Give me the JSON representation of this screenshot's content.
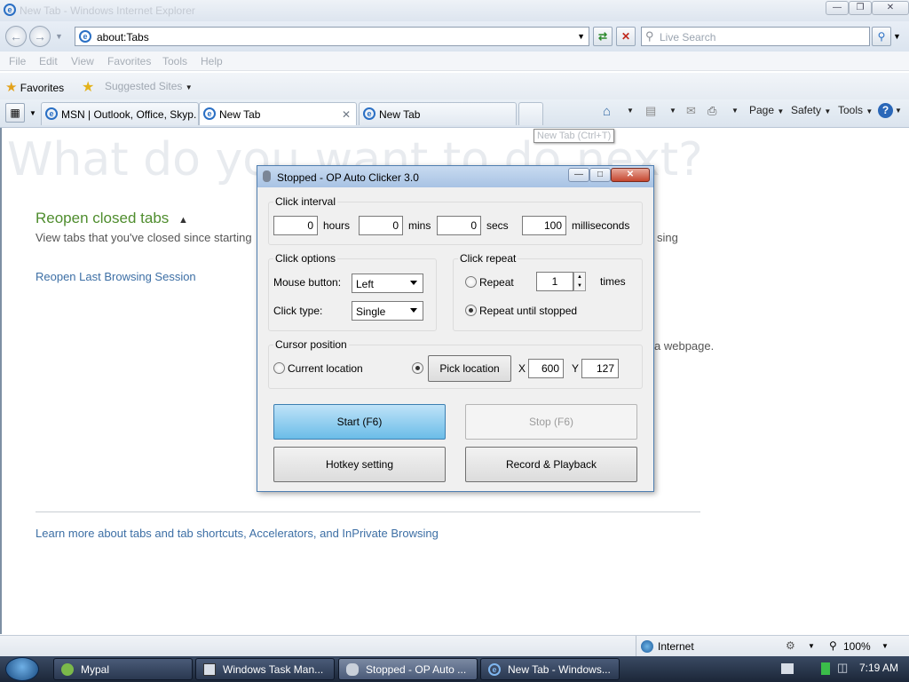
{
  "browser": {
    "window_title": "New Tab - Windows Internet Explorer",
    "address": "about:Tabs",
    "search_placeholder": "Live Search",
    "menu": [
      "File",
      "Edit",
      "View",
      "Favorites",
      "Tools",
      "Help"
    ],
    "favorites_label": "Favorites",
    "suggested_sites_label": "Suggested Sites",
    "tabs": [
      {
        "label": "MSN | Outlook, Office, Skyp..."
      },
      {
        "label": "New Tab"
      },
      {
        "label": "New Tab"
      }
    ],
    "command_bar": {
      "page": "Page",
      "safety": "Safety",
      "tools": "Tools"
    },
    "tooltip": "New Tab (Ctrl+T)"
  },
  "page": {
    "heading": "What do you want to do next?",
    "reopen_closed_tabs": "Reopen closed tabs",
    "view_tabs_text": "View tabs that you've closed since starting",
    "view_tabs_tail": "sing",
    "reopen_last_session": "Reopen Last Browsing Session",
    "webpage_tail": "a webpage.",
    "learn_more": "Learn more about tabs and tab shortcuts, Accelerators, and InPrivate Browsing"
  },
  "status": {
    "zone": "Internet",
    "zoom": "100%"
  },
  "taskbar": {
    "items": [
      "Mypal",
      "Windows Task Man...",
      "Stopped - OP Auto ...",
      "New Tab - Windows..."
    ],
    "clock": "7:19 AM"
  },
  "dialog": {
    "title": "Stopped - OP Auto Clicker 3.0",
    "click_interval": {
      "label": "Click interval",
      "hours": "0",
      "hours_label": "hours",
      "mins": "0",
      "mins_label": "mins",
      "secs": "0",
      "secs_label": "secs",
      "ms": "100",
      "ms_label": "milliseconds"
    },
    "click_options": {
      "label": "Click options",
      "mouse_button_label": "Mouse button:",
      "mouse_button_value": "Left",
      "click_type_label": "Click type:",
      "click_type_value": "Single"
    },
    "click_repeat": {
      "label": "Click repeat",
      "repeat_label": "Repeat",
      "repeat_count": "1",
      "times_label": "times",
      "repeat_until_stopped_label": "Repeat until stopped",
      "selected": "repeat_until_stopped"
    },
    "cursor_position": {
      "label": "Cursor position",
      "current_location_label": "Current location",
      "pick_location_label": "Pick location",
      "x_label": "X",
      "x_value": "600",
      "y_label": "Y",
      "y_value": "127",
      "selected": "pick_location"
    },
    "buttons": {
      "start": "Start (F6)",
      "stop": "Stop (F6)",
      "hotkey": "Hotkey setting",
      "record": "Record & Playback"
    }
  },
  "colors": {
    "accent_green": "#4f8d2e",
    "link_blue": "#3d6fa5",
    "start_button": "#6bbde8"
  }
}
